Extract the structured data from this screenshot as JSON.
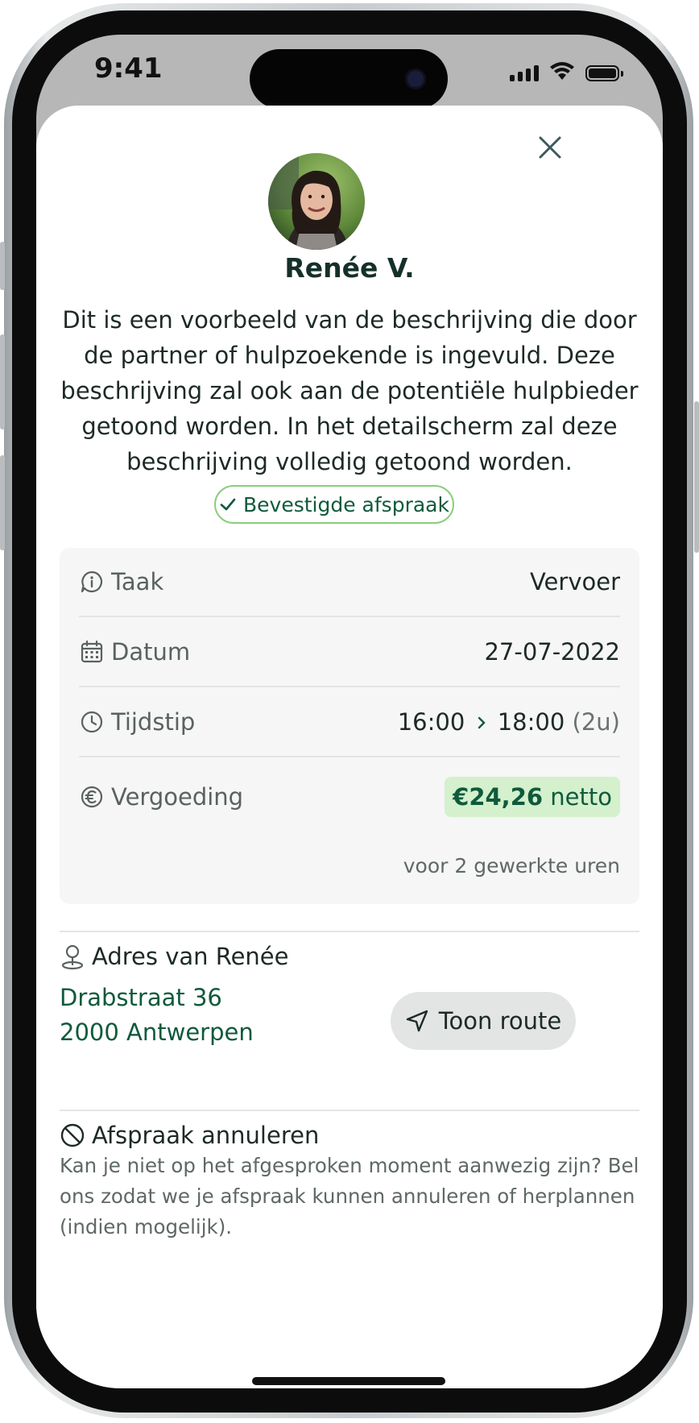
{
  "status_bar": {
    "time": "9:41"
  },
  "profile": {
    "name": "Renée V."
  },
  "description": "Dit is een voorbeeld van de beschrijving die door de partner of hulpzoekende is ingevuld. Deze beschrijving zal ook aan de potentiële hulpbieder getoond worden. In het detailscherm zal deze beschrijving volledig getoond worden.",
  "status_badge": {
    "label": "Bevestigde afspraak"
  },
  "details": {
    "task": {
      "label": "Taak",
      "value": "Vervoer"
    },
    "date": {
      "label": "Datum",
      "value": "27-07-2022"
    },
    "time": {
      "label": "Tijdstip",
      "start": "16:00",
      "end": "18:00",
      "duration": "(2u)"
    },
    "fee": {
      "label": "Vergoeding",
      "amount": "€24,26",
      "suffix": "netto",
      "note": "voor 2 gewerkte uren"
    }
  },
  "address": {
    "title": "Adres van Renée",
    "line1": "Drabstraat 36",
    "line2": "2000 Antwerpen",
    "route_button": "Toon route"
  },
  "cancel": {
    "title": "Afspraak annuleren",
    "text": "Kan je niet op het afgesproken moment aanwezig zijn? Bel ons zodat we je afspraak kunnen annuleren of herplannen (indien mogelijk)."
  },
  "colors": {
    "brand_green": "#0f5a3c",
    "badge_border": "#8bcd7d",
    "fee_background": "#d4f0cd",
    "card_background": "#f6f6f6"
  }
}
